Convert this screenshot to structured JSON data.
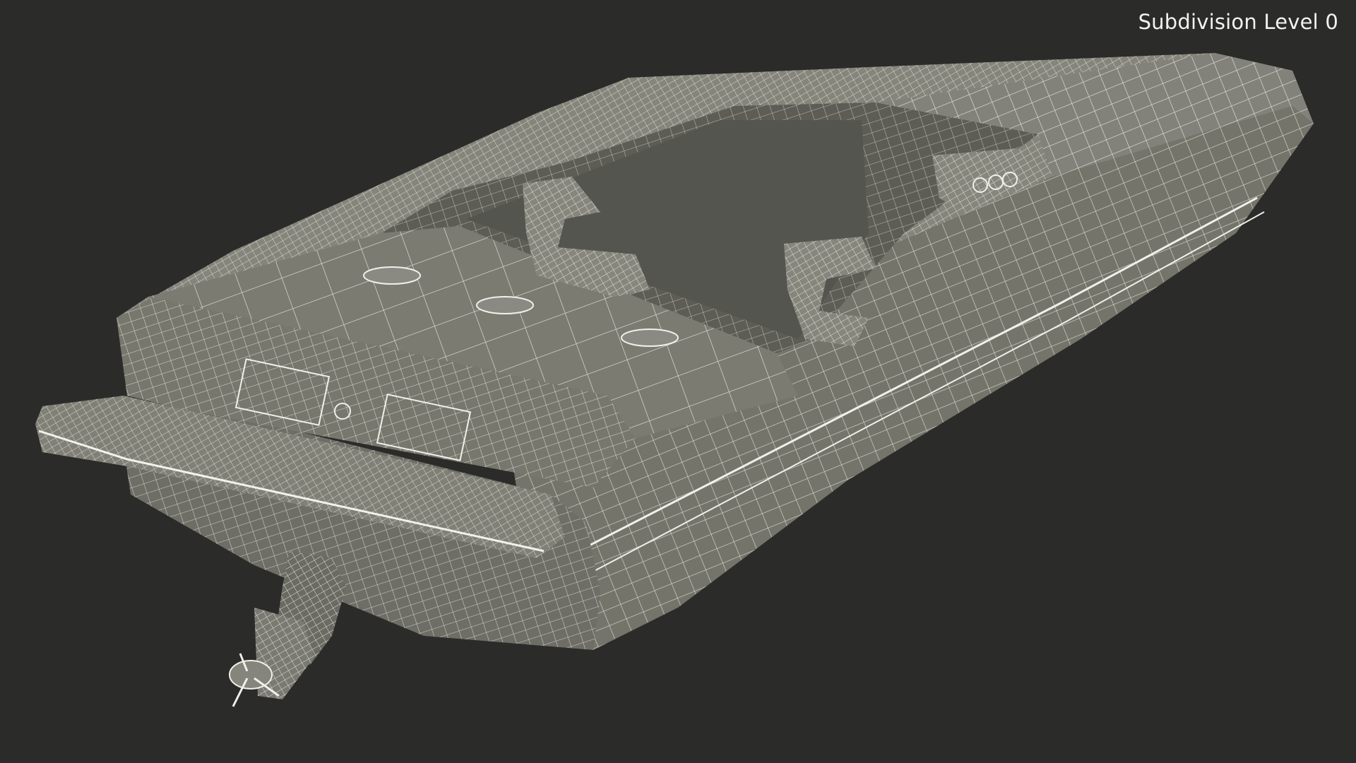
{
  "viewport": {
    "subdivision_label": "Subdivision Level 0",
    "background_color": "#2b2b2a",
    "hull_color": "#77776e",
    "wire_color": "#e9e9e2"
  },
  "subject": {
    "icon": "speedboat-wireframe-icon"
  }
}
